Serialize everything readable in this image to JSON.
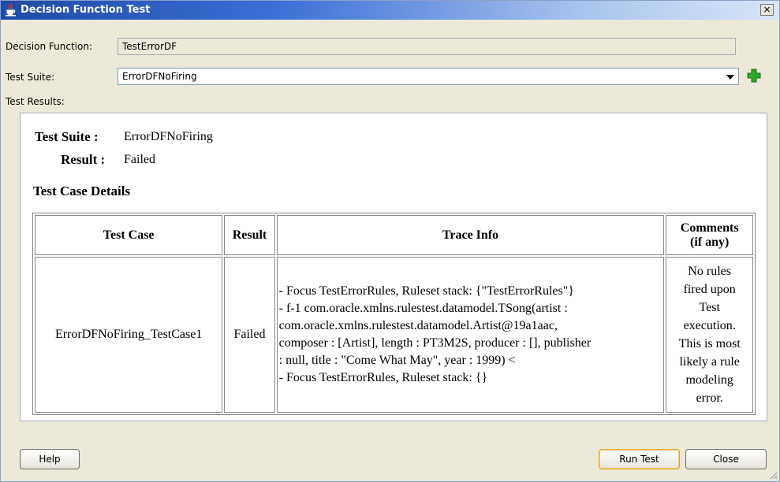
{
  "window": {
    "title": "Decision Function Test",
    "close_label": "×",
    "icon": "java-cup-icon"
  },
  "form": {
    "decision_function_label": "Decision Function:",
    "decision_function_value": "TestErrorDF",
    "test_suite_label": "Test Suite:",
    "test_suite_value": "ErrorDFNoFiring",
    "test_results_label": "Test Results:"
  },
  "results": {
    "suite_label": "Test Suite :",
    "suite_value": "ErrorDFNoFiring",
    "result_label": "Result :",
    "result_value": "Failed",
    "details_title": "Test Case Details",
    "table": {
      "headers": [
        "Test Case",
        "Result",
        "Trace Info",
        "Comments",
        "(if any)"
      ],
      "row": {
        "test_case": "ErrorDFNoFiring_TestCase1",
        "result": "Failed",
        "trace_lines": [
          "- Focus TestErrorRules, Ruleset stack: {\"TestErrorRules\"}",
          "- f-1 com.oracle.xmlns.rulestest.datamodel.TSong(artist :",
          "com.oracle.xmlns.rulestest.datamodel.Artist@19a1aac,",
          "composer : [Artist], length : PT3M2S, producer : [], publisher",
          ": null, title : \"Come What May\", year : 1999) <",
          "- Focus TestErrorRules, Ruleset stack: {}"
        ],
        "comment_lines": [
          "No rules",
          "fired upon",
          "Test",
          "execution.",
          "This is most",
          "likely a rule",
          "modeling",
          "error."
        ]
      }
    }
  },
  "buttons": {
    "help": "Help",
    "run_test": "Run Test",
    "close": "Close"
  },
  "colors": {
    "titlebar_start": "#1f4aa6",
    "dialog_bg": "#ece9d8",
    "primary_button_border": "#e3a42b",
    "add_icon": "#2ea82e"
  }
}
